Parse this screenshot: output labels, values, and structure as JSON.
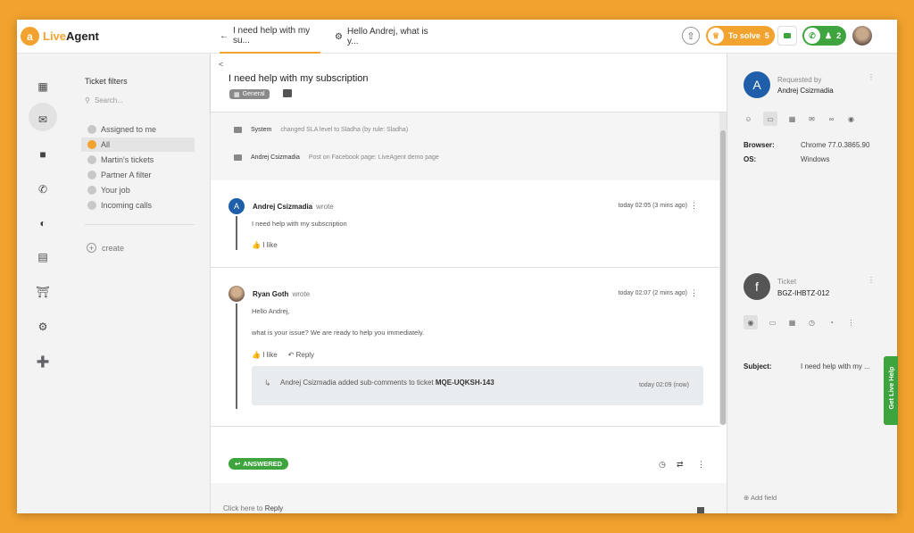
{
  "app": {
    "name_part1": "Live",
    "name_part2": "Agent",
    "logo_letter": "a"
  },
  "tabs": [
    {
      "label": "I need help with my su...",
      "icon": "back-arrow-icon"
    },
    {
      "label": "Hello Andrej, what is y...",
      "icon": "gear-icon"
    }
  ],
  "topbar": {
    "to_solve_label": "To solve",
    "to_solve_count": "5",
    "calls_count": "2",
    "accent_color": "#f2a22e",
    "online_color": "#3ea53e"
  },
  "filters": {
    "title": "Ticket filters",
    "search_placeholder": "Search...",
    "items": [
      "Assigned to me",
      "All",
      "Martin's tickets",
      "Partner A filter",
      "Your job",
      "Incoming calls"
    ],
    "selected": "All",
    "create_label": "create"
  },
  "ticket": {
    "back_label": "<",
    "title": "I need help with my subscription",
    "department": "General",
    "system_log": [
      {
        "author": "System",
        "text": "changed SLA level to Sladha (by rule: Sladha)"
      },
      {
        "author": "Andrej Csizmadia",
        "text": "Post on Facebook page: LiveAgent demo page"
      }
    ],
    "messages": [
      {
        "avatar_letter": "A",
        "author": "Andrej Csizmadia",
        "verb": "wrote",
        "time": "today 02:05 (3 mins ago)",
        "text": "I need help with my subscription",
        "like": "I like"
      },
      {
        "author": "Ryan Goth",
        "verb": "wrote",
        "time": "today 02:07 (2 mins ago)",
        "line1": "Hello Andrej,",
        "line2": "what is your issue? We are ready to help you immediately.",
        "like": "I like",
        "reply": "Reply",
        "sub_comment": {
          "text": "Andrej Csizmadia added sub-comments to ticket",
          "ticket_id": "MQE-UQKSH-143",
          "time": "today 02:09 (now)"
        }
      }
    ],
    "status": "ANSWERED",
    "reply_prefix": "Click here to",
    "reply_action": "Reply"
  },
  "requester": {
    "label": "Requested by",
    "name": "Andrej Csizmadia",
    "avatar_letter": "A",
    "browser_key": "Browser:",
    "browser_val": "Chrome 77.0.3865.90",
    "os_key": "OS:",
    "os_val": "Windows"
  },
  "ticket_info": {
    "label": "Ticket",
    "id": "BGZ-IHBTZ-012",
    "avatar_letter": "f",
    "subject_key": "Subject:",
    "subject_val": "I need help with my ...",
    "add_field": "Add field"
  },
  "live_help": "Get Live Help"
}
